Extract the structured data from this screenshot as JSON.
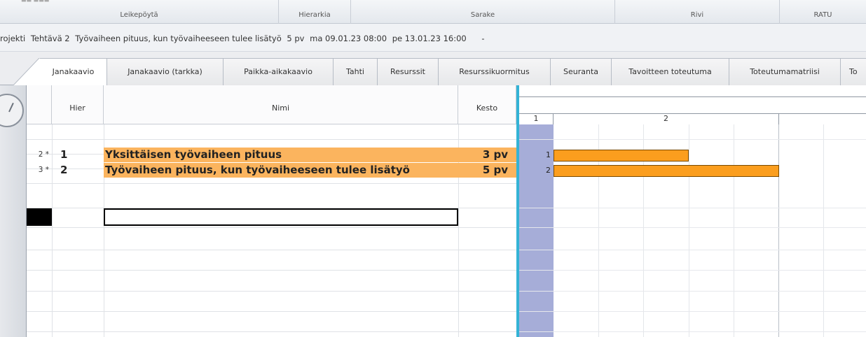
{
  "ribbon": {
    "groups": [
      {
        "label": "Leikepöytä"
      },
      {
        "label": "Hierarkia"
      },
      {
        "label": "Sarake"
      },
      {
        "label": "Rivi"
      },
      {
        "label": "RATU"
      }
    ]
  },
  "infobar": {
    "project": "rojekti",
    "task": "Tehtävä 2",
    "task_name": "Työvaiheen pituus, kun työvaiheeseen tulee lisätyö",
    "duration": "5 pv",
    "start": "ma 09.01.23 08:00",
    "end": "pe 13.01.23 16:00",
    "dash": "-"
  },
  "tabs": [
    {
      "label": "Janakaavio",
      "active": true
    },
    {
      "label": "Janakaavio (tarkka)"
    },
    {
      "label": "Paikka-aikakaavio"
    },
    {
      "label": "Tahti"
    },
    {
      "label": "Resurssit"
    },
    {
      "label": "Resurssikuormitus"
    },
    {
      "label": "Seuranta"
    },
    {
      "label": "Tavoitteen toteutuma"
    },
    {
      "label": "Toteutumamatriisi"
    },
    {
      "label": "To"
    }
  ],
  "grid": {
    "headers": {
      "hier": "Hier",
      "name": "Nimi",
      "duration": "Kesto"
    },
    "rows": [
      {
        "row_num": "2 *",
        "hier": "1",
        "name": "Yksittäisen työvaiheen pituus",
        "duration": "3 pv",
        "gantt_label": "1"
      },
      {
        "row_num": "3 *",
        "hier": "2",
        "name": "Työvaiheen pituus, kun työvaiheeseen tulee lisätyö",
        "duration": "5 pv",
        "gantt_label": "2"
      }
    ],
    "new_row_name_value": ""
  },
  "gantt": {
    "weeks": [
      "1",
      "2"
    ],
    "bar_color": "#fb9e1e",
    "weekend_color": "#a6add8",
    "row_highlight_color": "#fbb45e"
  }
}
